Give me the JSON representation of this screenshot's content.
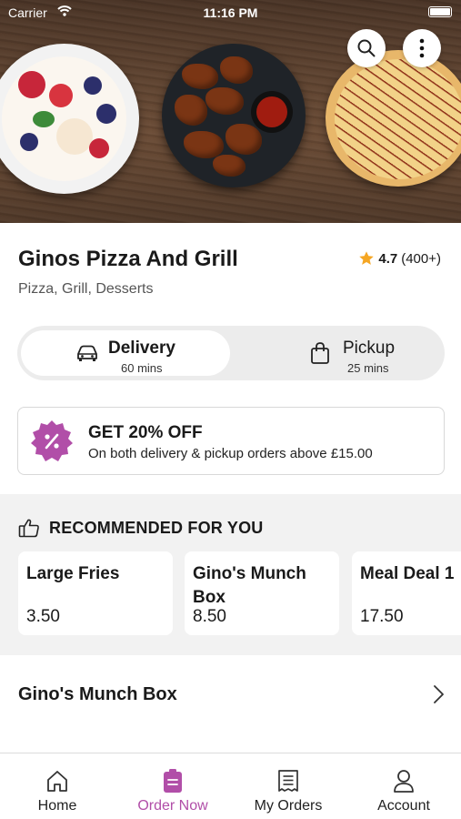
{
  "status_bar": {
    "carrier": "Carrier",
    "time": "11:16 PM"
  },
  "restaurant": {
    "name": "Ginos Pizza And Grill",
    "rating": "4.7",
    "rating_count": "(400+)",
    "cuisines": "Pizza, Grill, Desserts"
  },
  "fulfilment": {
    "delivery": {
      "label": "Delivery",
      "time": "60 mins",
      "selected": true
    },
    "pickup": {
      "label": "Pickup",
      "time": "25 mins",
      "selected": false
    }
  },
  "offer": {
    "title": "GET 20% OFF",
    "description": "On both delivery & pickup orders above £15.00"
  },
  "recommended": {
    "heading": "RECOMMENDED FOR YOU",
    "items": [
      {
        "name": "Large Fries",
        "price": "3.50"
      },
      {
        "name": "Gino's Munch Box",
        "price": "8.50"
      },
      {
        "name": "Meal Deal 1",
        "price": "17.50"
      }
    ]
  },
  "menu_sections": [
    {
      "name": "Gino's Munch Box"
    }
  ],
  "tab_bar": {
    "items": [
      {
        "label": "Home",
        "icon": "home-icon"
      },
      {
        "label": "Order Now",
        "icon": "order-bag-icon"
      },
      {
        "label": "My Orders",
        "icon": "receipt-icon"
      },
      {
        "label": "Account",
        "icon": "person-icon"
      }
    ],
    "active_index": 1
  },
  "colors": {
    "accent": "#b14ea8",
    "toggle_track": "#ececec",
    "section_bg": "#f2f2f2",
    "star": "#f5a623"
  }
}
